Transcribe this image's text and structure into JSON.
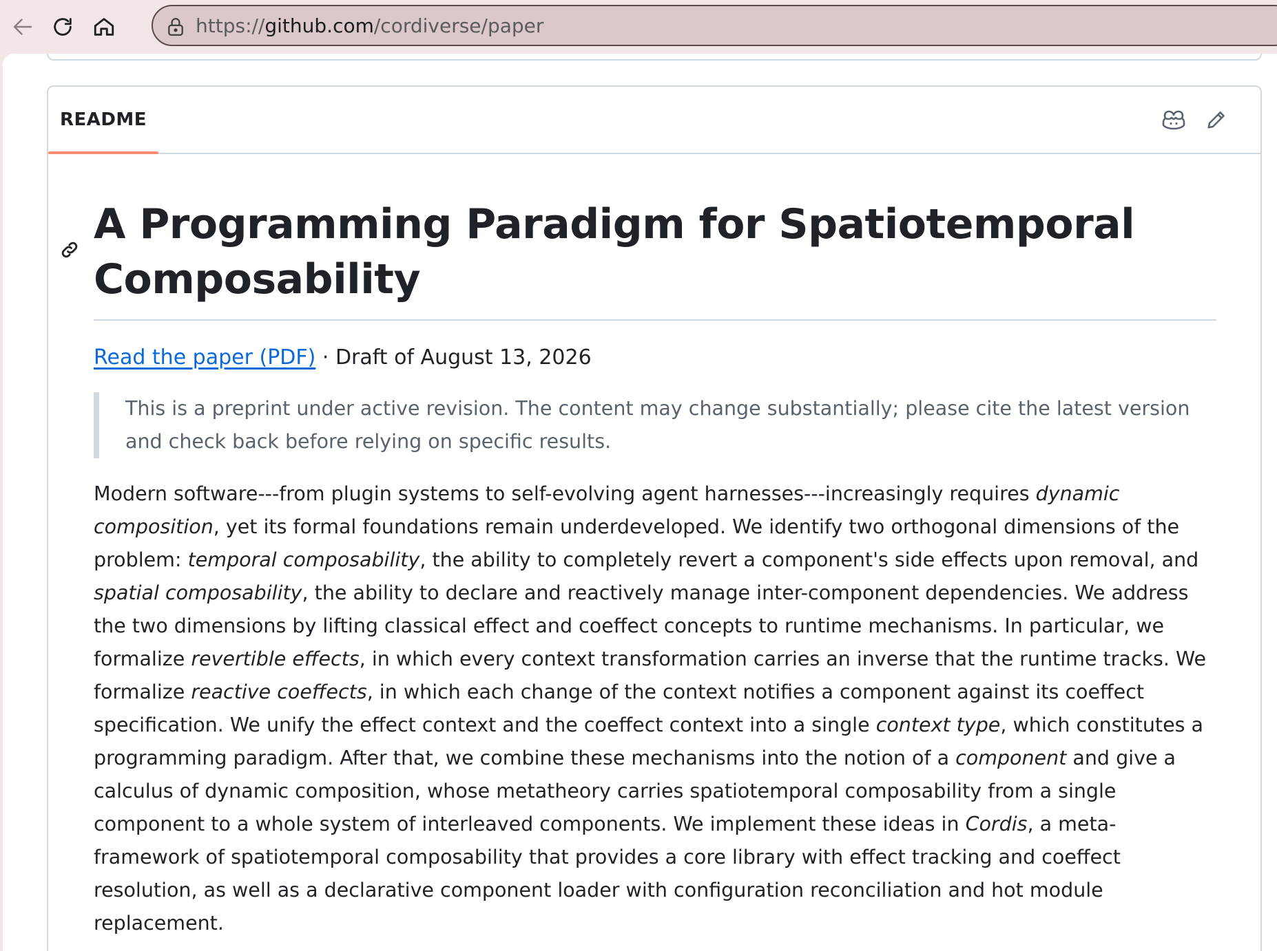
{
  "browser": {
    "url_scheme": "https://",
    "url_domain": "github.com",
    "url_path": "/cordiverse/paper"
  },
  "readme": {
    "tab_label": "README",
    "title": "A Programming Paradigm for Spatiotemporal Composability",
    "pdf_link": "Read the paper (PDF)",
    "draft_text": " · Draft of August 13, 2026",
    "notice": "This is a preprint under active revision. The content may change substantially; please cite the latest version and check back before relying on specific results.",
    "abstract": [
      {
        "text": "Modern software---from plugin systems to self-evolving agent harnesses---increasingly requires ",
        "em": false
      },
      {
        "text": "dynamic composition",
        "em": true
      },
      {
        "text": ", yet its formal foundations remain underdeveloped. We identify two orthogonal dimensions of the problem: ",
        "em": false
      },
      {
        "text": "temporal composability",
        "em": true
      },
      {
        "text": ", the ability to completely revert a component's side effects upon removal, and ",
        "em": false
      },
      {
        "text": "spatial composability",
        "em": true
      },
      {
        "text": ", the ability to declare and reactively manage inter-component dependencies. We address the two dimensions by lifting classical effect and coeffect concepts to runtime mechanisms. In particular, we formalize ",
        "em": false
      },
      {
        "text": "revertible effects",
        "em": true
      },
      {
        "text": ", in which every context transformation carries an inverse that the runtime tracks. We formalize ",
        "em": false
      },
      {
        "text": "reactive coeffects",
        "em": true
      },
      {
        "text": ", in which each change of the context notifies a component against its coeffect specification. We unify the effect context and the coeffect context into a single ",
        "em": false
      },
      {
        "text": "context type",
        "em": true
      },
      {
        "text": ", which constitutes a programming paradigm. After that, we combine these mechanisms into the notion of a ",
        "em": false
      },
      {
        "text": "component",
        "em": true
      },
      {
        "text": " and give a calculus of dynamic composition, whose metatheory carries spatiotemporal composability from a single component to a whole system of interleaved components. We implement these ideas in ",
        "em": false
      },
      {
        "text": "Cordis",
        "em": true
      },
      {
        "text": ", a meta-framework of spatiotemporal composability that provides a core library with effect tracking and coeffect resolution, as well as a declarative component loader with configuration reconciliation and hot module replacement.",
        "em": false
      }
    ]
  },
  "icons": {
    "back": "back-arrow-icon",
    "reload": "reload-icon",
    "home": "home-icon",
    "lock": "lock-icon",
    "copilot": "copilot-icon",
    "edit": "pencil-icon",
    "anchor": "link-icon"
  },
  "colors": {
    "link": "#0969da",
    "tab_underline": "#fd8c73",
    "chrome_bg": "#f3e6e6"
  }
}
